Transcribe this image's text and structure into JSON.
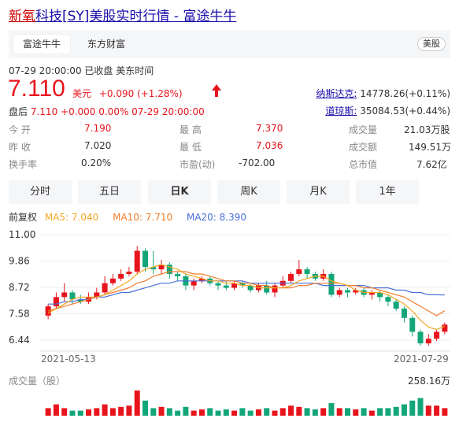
{
  "title": {
    "hl": "新氧",
    "rest": "科技[SY]美股实时行情 - 富途牛牛"
  },
  "source_tabs": [
    "富途牛牛",
    "东方财富"
  ],
  "market_badge": "美股",
  "time_line": "07-29 20:00:00   已收盘   美东时间",
  "price": "7.110",
  "currency": "美元",
  "change": "+0.090 (+1.28%)",
  "indices": [
    {
      "name": "纳斯达克:",
      "value": "14778.26(+0.11%)"
    },
    {
      "name": "道琼斯:",
      "value": "35084.53(+0.44%)"
    }
  ],
  "after_hours": {
    "label": "盘后",
    "value": "7.110  +0.000  0.00%  07-29 20:00:00"
  },
  "stats": [
    {
      "label": "今  开",
      "value": "7.190",
      "red": true
    },
    {
      "label": "最  高",
      "value": "7.370",
      "red": true
    },
    {
      "label": "成交量",
      "value": "21.03万股",
      "red": false
    },
    {
      "label": "昨  收",
      "value": "7.020",
      "red": false
    },
    {
      "label": "最  低",
      "value": "7.036",
      "red": true
    },
    {
      "label": "成交额",
      "value": "149.51万",
      "red": false
    },
    {
      "label": "换手率",
      "value": "0.20%",
      "red": false
    },
    {
      "label": "市盈(动)",
      "value": "-702.00",
      "red": false
    },
    {
      "label": "总市值",
      "value": "7.62亿",
      "red": false
    }
  ],
  "periods": [
    "分时",
    "五日",
    "日K",
    "周K",
    "月K",
    "1年"
  ],
  "ma_line": {
    "label": "前复权",
    "ma5": "MA5: 7.040",
    "ma10": "MA10: 7.710",
    "ma20": "MA20: 8.390"
  },
  "colors": {
    "up": "#e8141c",
    "down": "#13a679",
    "ma5": "#f5a623",
    "ma10": "#f07d2e",
    "ma20": "#4a6fd8"
  },
  "chart_data": {
    "type": "candlestick",
    "y_ticks": [
      "11.00",
      "9.86",
      "8.72",
      "7.58",
      "6.44"
    ],
    "ylim": [
      5.9,
      11.0
    ],
    "x_labels": [
      "2021-05-13",
      "2021-07-29"
    ],
    "candles": [
      [
        7.5,
        7.9,
        7.35,
        8.0
      ],
      [
        7.9,
        8.3,
        7.8,
        8.5
      ],
      [
        8.3,
        8.5,
        8.1,
        8.9
      ],
      [
        8.5,
        8.2,
        8.0,
        8.6
      ],
      [
        8.2,
        8.1,
        8.0,
        8.4
      ],
      [
        8.1,
        8.3,
        8.0,
        8.5
      ],
      [
        8.3,
        8.5,
        8.2,
        8.7
      ],
      [
        8.5,
        8.9,
        8.4,
        9.2
      ],
      [
        8.9,
        9.1,
        8.8,
        9.3
      ],
      [
        9.1,
        9.3,
        9.0,
        9.5
      ],
      [
        9.3,
        9.4,
        9.2,
        9.6
      ],
      [
        9.4,
        10.3,
        9.3,
        10.5
      ],
      [
        10.3,
        9.6,
        9.4,
        10.4
      ],
      [
        9.6,
        9.5,
        9.3,
        10.3
      ],
      [
        9.5,
        9.7,
        9.3,
        9.9
      ],
      [
        9.7,
        9.3,
        9.1,
        9.8
      ],
      [
        9.3,
        9.2,
        9.0,
        9.4
      ],
      [
        9.2,
        8.8,
        8.6,
        9.3
      ],
      [
        8.8,
        9.0,
        8.6,
        9.1
      ],
      [
        9.0,
        9.1,
        8.9,
        9.2
      ],
      [
        9.1,
        8.9,
        8.8,
        9.2
      ],
      [
        8.9,
        8.8,
        8.6,
        9.0
      ],
      [
        8.8,
        8.7,
        8.6,
        9.0
      ],
      [
        8.7,
        8.9,
        8.6,
        9.0
      ],
      [
        8.9,
        8.8,
        8.7,
        9.0
      ],
      [
        8.8,
        8.6,
        8.5,
        8.9
      ],
      [
        8.6,
        8.8,
        8.5,
        8.9
      ],
      [
        8.8,
        8.5,
        8.4,
        9.0
      ],
      [
        8.5,
        8.8,
        8.3,
        8.9
      ],
      [
        8.8,
        9.0,
        8.7,
        9.2
      ],
      [
        9.0,
        9.3,
        8.9,
        9.4
      ],
      [
        9.3,
        9.5,
        9.2,
        9.9
      ],
      [
        9.5,
        9.3,
        9.1,
        9.6
      ],
      [
        9.3,
        9.1,
        9.0,
        9.4
      ],
      [
        9.1,
        9.3,
        9.0,
        9.5
      ],
      [
        9.3,
        8.4,
        8.3,
        9.4
      ],
      [
        8.4,
        8.6,
        8.3,
        8.7
      ],
      [
        8.6,
        8.5,
        8.3,
        8.7
      ],
      [
        8.5,
        8.6,
        8.4,
        8.7
      ],
      [
        8.6,
        8.4,
        8.3,
        8.7
      ],
      [
        8.4,
        8.5,
        8.2,
        8.6
      ],
      [
        8.5,
        8.3,
        8.1,
        8.6
      ],
      [
        8.3,
        8.1,
        7.9,
        8.4
      ],
      [
        8.1,
        7.8,
        7.7,
        8.2
      ],
      [
        7.8,
        7.4,
        7.2,
        7.9
      ],
      [
        7.4,
        6.8,
        6.6,
        7.5
      ],
      [
        6.8,
        6.3,
        6.2,
        6.9
      ],
      [
        6.3,
        6.5,
        6.2,
        6.7
      ],
      [
        6.5,
        6.8,
        6.4,
        6.9
      ],
      [
        6.8,
        7.11,
        6.7,
        7.2
      ]
    ],
    "ma5": [
      7.6,
      7.8,
      8.0,
      8.2,
      8.3,
      8.3,
      8.3,
      8.4,
      8.6,
      8.8,
      9.0,
      9.3,
      9.5,
      9.6,
      9.7,
      9.6,
      9.5,
      9.3,
      9.2,
      9.1,
      9.0,
      9.0,
      8.9,
      8.9,
      8.8,
      8.8,
      8.7,
      8.7,
      8.7,
      8.7,
      8.8,
      9.0,
      9.1,
      9.2,
      9.2,
      9.0,
      8.9,
      8.8,
      8.6,
      8.5,
      8.5,
      8.5,
      8.4,
      8.2,
      8.0,
      7.7,
      7.3,
      7.0,
      6.9,
      7.04
    ],
    "ma10": [
      7.7,
      7.8,
      7.9,
      8.0,
      8.1,
      8.2,
      8.3,
      8.4,
      8.5,
      8.6,
      8.7,
      8.9,
      9.0,
      9.2,
      9.3,
      9.4,
      9.4,
      9.4,
      9.3,
      9.3,
      9.2,
      9.1,
      9.0,
      9.0,
      8.9,
      8.9,
      8.8,
      8.8,
      8.7,
      8.7,
      8.7,
      8.8,
      8.8,
      8.9,
      8.9,
      8.9,
      8.9,
      8.8,
      8.8,
      8.7,
      8.7,
      8.6,
      8.5,
      8.4,
      8.3,
      8.1,
      7.9,
      7.7,
      7.5,
      7.71
    ],
    "ma20": [
      8.0,
      8.0,
      8.1,
      8.1,
      8.2,
      8.2,
      8.3,
      8.3,
      8.4,
      8.5,
      8.5,
      8.6,
      8.7,
      8.8,
      8.9,
      8.9,
      9.0,
      9.0,
      9.0,
      9.0,
      9.0,
      9.0,
      9.0,
      9.0,
      9.0,
      8.9,
      8.9,
      8.9,
      8.9,
      8.9,
      8.9,
      8.9,
      8.9,
      8.9,
      8.8,
      8.8,
      8.8,
      8.8,
      8.8,
      8.8,
      8.7,
      8.7,
      8.7,
      8.6,
      8.6,
      8.5,
      8.5,
      8.4,
      8.4,
      8.39
    ],
    "volume_label": "成交量（股）",
    "volume_max": "258.16万",
    "volumes": [
      0.3,
      0.45,
      0.3,
      0.2,
      0.2,
      0.25,
      0.3,
      0.45,
      0.3,
      0.35,
      0.4,
      1.0,
      0.6,
      0.3,
      0.35,
      0.3,
      0.2,
      0.35,
      0.2,
      0.25,
      0.3,
      0.2,
      0.25,
      0.2,
      0.3,
      0.2,
      0.25,
      0.3,
      0.2,
      0.3,
      0.4,
      0.35,
      0.3,
      0.25,
      0.3,
      0.5,
      0.3,
      0.3,
      0.25,
      0.3,
      0.2,
      0.3,
      0.3,
      0.35,
      0.45,
      0.6,
      0.7,
      0.4,
      0.4,
      0.3
    ]
  }
}
